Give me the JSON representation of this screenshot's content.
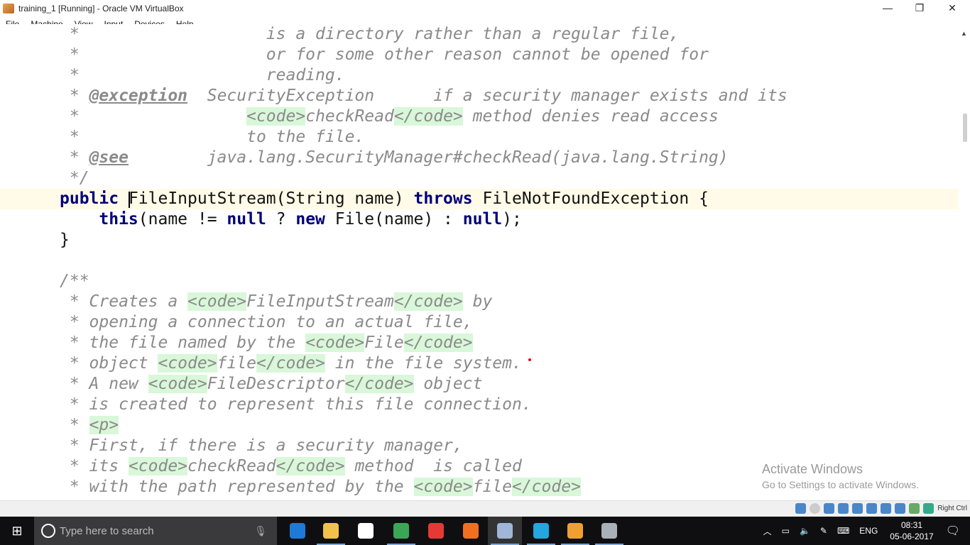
{
  "window": {
    "title": "training_1 [Running] - Oracle VM VirtualBox",
    "minimize": "—",
    "restore": "❐",
    "close": "✕"
  },
  "menu": [
    "File",
    "Machine",
    "View",
    "Input",
    "Devices",
    "Help"
  ],
  "code_lines": [
    [
      [
        "c",
        " *                   is a directory rather than a regular file,"
      ]
    ],
    [
      [
        "c",
        " *                   or for some other reason cannot be opened for"
      ]
    ],
    [
      [
        "c",
        " *                   reading."
      ]
    ],
    [
      [
        "c",
        " * "
      ],
      [
        "d",
        "@exception"
      ],
      [
        "c",
        "  SecurityException      if a security manager exists and its"
      ]
    ],
    [
      [
        "c",
        " *                 "
      ],
      [
        "t",
        "<code>"
      ],
      [
        "c",
        "checkRead"
      ],
      [
        "t",
        "</code>"
      ],
      [
        "c",
        " method denies read access"
      ]
    ],
    [
      [
        "c",
        " *                 to the file."
      ]
    ],
    [
      [
        "c",
        " * "
      ],
      [
        "d",
        "@see"
      ],
      [
        "c",
        "        java.lang.SecurityManager#checkRead(java.lang.String)"
      ]
    ],
    [
      [
        "c",
        " */"
      ]
    ],
    [
      [
        "k",
        "public"
      ],
      [
        "p",
        " FileInputStream(String name) "
      ],
      [
        "k",
        "throws"
      ],
      [
        "p",
        " FileNotFoundException {"
      ]
    ],
    [
      [
        "p",
        "    "
      ],
      [
        "k",
        "this"
      ],
      [
        "p",
        "(name != "
      ],
      [
        "k",
        "null"
      ],
      [
        "p",
        " ? "
      ],
      [
        "k",
        "new"
      ],
      [
        "p",
        " File(name) : "
      ],
      [
        "k",
        "null"
      ],
      [
        "p",
        ");"
      ]
    ],
    [
      [
        "p",
        "}"
      ]
    ],
    [],
    [
      [
        "c",
        "/**"
      ]
    ],
    [
      [
        "c",
        " * Creates a "
      ],
      [
        "t",
        "<code>"
      ],
      [
        "c",
        "FileInputStream"
      ],
      [
        "t",
        "</code>"
      ],
      [
        "c",
        " by"
      ]
    ],
    [
      [
        "c",
        " * opening a connection to an actual file,"
      ]
    ],
    [
      [
        "c",
        " * the file named by the "
      ],
      [
        "t",
        "<code>"
      ],
      [
        "c",
        "File"
      ],
      [
        "t",
        "</code>"
      ]
    ],
    [
      [
        "c",
        " * object "
      ],
      [
        "t",
        "<code>"
      ],
      [
        "c",
        "file"
      ],
      [
        "t",
        "</code>"
      ],
      [
        "c",
        " in the file system."
      ]
    ],
    [
      [
        "c",
        " * A new "
      ],
      [
        "t",
        "<code>"
      ],
      [
        "c",
        "FileDescriptor"
      ],
      [
        "t",
        "</code>"
      ],
      [
        "c",
        " object"
      ]
    ],
    [
      [
        "c",
        " * is created to represent this file connection."
      ]
    ],
    [
      [
        "c",
        " * "
      ],
      [
        "t",
        "<p>"
      ]
    ],
    [
      [
        "c",
        " * First, if there is a security manager,"
      ]
    ],
    [
      [
        "c",
        " * its "
      ],
      [
        "t",
        "<code>"
      ],
      [
        "c",
        "checkRead"
      ],
      [
        "t",
        "</code>"
      ],
      [
        "c",
        " method  is called"
      ]
    ],
    [
      [
        "c",
        " * with the path represented by the "
      ],
      [
        "t",
        "<code>"
      ],
      [
        "c",
        "file"
      ],
      [
        "t",
        "</code>"
      ]
    ]
  ],
  "watermark": {
    "line1": "Activate Windows",
    "line2": "Go to Settings to activate Windows."
  },
  "vbox_status": {
    "host_key": "Right Ctrl"
  },
  "taskbar": {
    "search_placeholder": "Type here to search",
    "apps": [
      {
        "name": "edge",
        "color": "#1e7ad6",
        "running": false
      },
      {
        "name": "file-explorer",
        "color": "#f0c24a",
        "running": true
      },
      {
        "name": "store",
        "color": "#ffffff",
        "running": false
      },
      {
        "name": "chrome",
        "color": "#3aa757",
        "running": true
      },
      {
        "name": "screen-recorder",
        "color": "#e53935",
        "running": false
      },
      {
        "name": "firefox",
        "color": "#f07020",
        "running": false
      },
      {
        "name": "virtualbox",
        "color": "#9fb6d6",
        "running": true,
        "active": true
      },
      {
        "name": "skype",
        "color": "#22a7e0",
        "running": true
      },
      {
        "name": "app-orange",
        "color": "#f0a030",
        "running": true
      },
      {
        "name": "app-paint",
        "color": "#aab0b8",
        "running": true
      }
    ],
    "tray": {
      "language": "ENG",
      "time": "08:31",
      "date": "05-06-2017"
    }
  },
  "colors": {
    "keyword": "#00007a",
    "comment": "#8a8a8a",
    "html_tag_bg": "#d9f7d9",
    "current_line": "#fffbe8"
  }
}
